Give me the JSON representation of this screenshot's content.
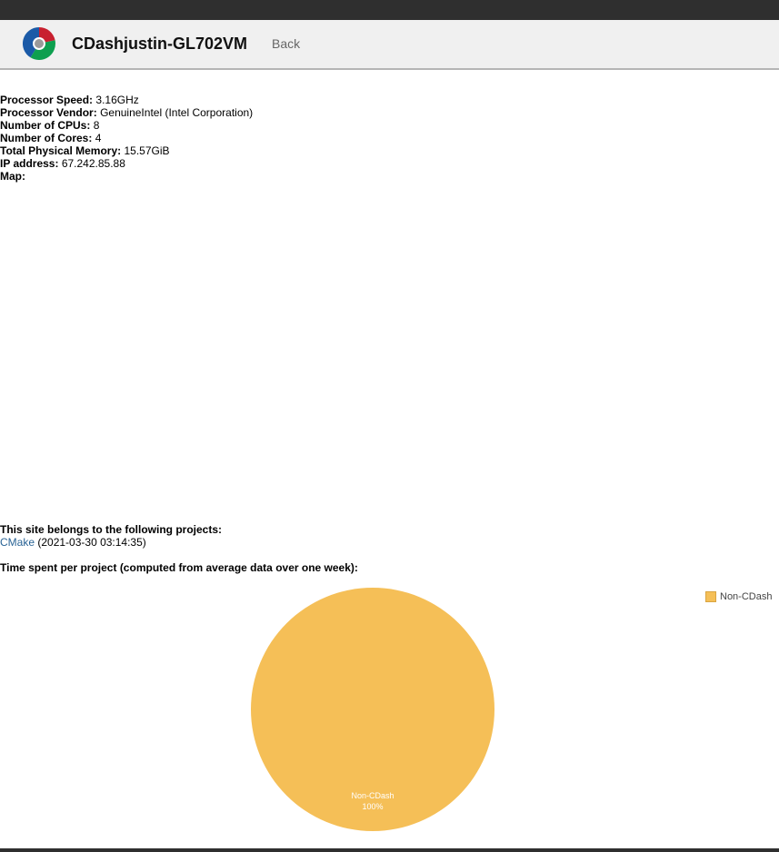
{
  "header": {
    "title": "CDashjustin-GL702VM",
    "back_label": "Back"
  },
  "site_info": [
    {
      "label": "Processor Speed:",
      "value": "3.16GHz"
    },
    {
      "label": "Processor Vendor:",
      "value": "GenuineIntel (Intel Corporation)"
    },
    {
      "label": "Number of CPUs:",
      "value": "8"
    },
    {
      "label": "Number of Cores:",
      "value": "4"
    },
    {
      "label": "Total Physical Memory:",
      "value": "15.57GiB"
    },
    {
      "label": "IP address:",
      "value": "67.242.85.88"
    },
    {
      "label": "Map:",
      "value": ""
    }
  ],
  "projects": {
    "heading": "This site belongs to the following projects:",
    "items": [
      {
        "name": "CMake",
        "date": "(2021-03-30 03:14:35)"
      }
    ]
  },
  "time_section": {
    "heading": "Time spent per project (computed from average data over one week):"
  },
  "chart_data": {
    "type": "pie",
    "slices": [
      {
        "label": "Non-CDash",
        "value": 100,
        "percent_label": "100%",
        "color": "#f5bf57"
      }
    ],
    "legend": [
      "Non-CDash"
    ],
    "legend_position": "top-right"
  },
  "colors": {
    "header_bg": "#f0f0f0",
    "top_bar": "#2f2f2f",
    "link": "#2a6496",
    "slice": "#f5bf57"
  }
}
